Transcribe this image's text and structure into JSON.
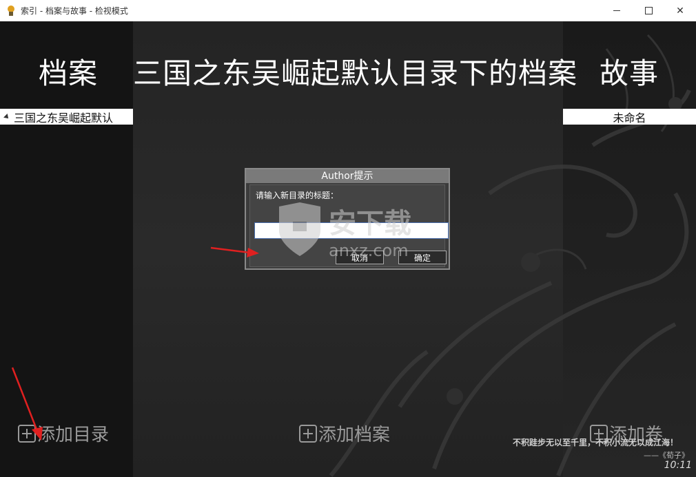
{
  "window": {
    "title": "索引 - 档案与故事 - 检视模式",
    "controls": {
      "minimize": "minimize",
      "maximize": "maximize",
      "close": "✕"
    }
  },
  "header": {
    "left": "档案",
    "center": "三国之东吴崛起默认目录下的档案",
    "right": "故事"
  },
  "tree": {
    "selected_item": "三国之东吴崛起默认"
  },
  "story_list": {
    "selected_item": "未命名"
  },
  "bottom": {
    "add_directory": "添加目录",
    "add_file": "添加档案",
    "add_volume": "添加卷"
  },
  "quote": {
    "text": "不积跬步无以至千里，不积小流无以成江海！",
    "source": "——《荀子》",
    "time": "10:11"
  },
  "dialog": {
    "title": "Author提示",
    "prompt": "请输入新目录的标题：",
    "input_value": "",
    "cancel_label": "取消",
    "ok_label": "确定"
  },
  "watermark": {
    "text_cn": "安下载",
    "text_en": "anxz.com"
  },
  "colors": {
    "arrow": "#e02020",
    "accent": "#4a6fb0"
  }
}
